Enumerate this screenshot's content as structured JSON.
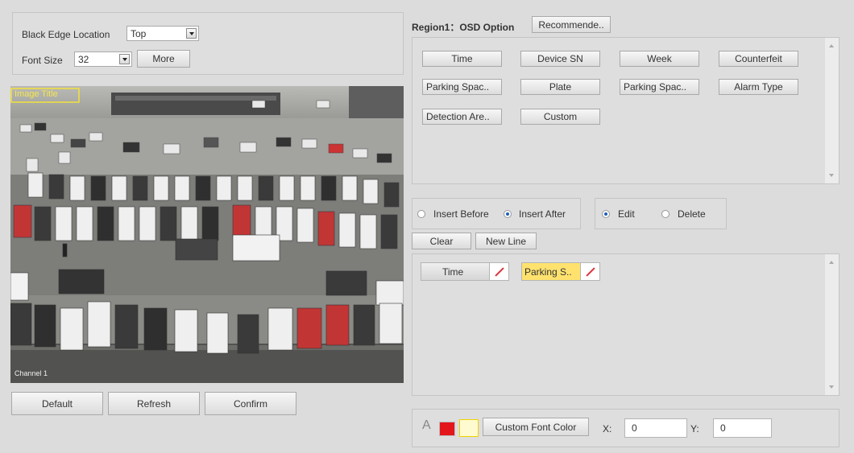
{
  "left": {
    "black_edge_location_label": "Black Edge Location",
    "black_edge_location_value": "Top",
    "font_size_label": "Font Size",
    "font_size_value": "32",
    "more_button": "More",
    "video_overlay": {
      "title_text": "Image Title",
      "channel_text": "Channel 1"
    },
    "default_button": "Default",
    "refresh_button": "Refresh",
    "confirm_button": "Confirm"
  },
  "right": {
    "region_title": "Region1：OSD Option",
    "recommended_button": "Recommende..",
    "osd_options": [
      "Time",
      "Device SN",
      "Week",
      "Counterfeit",
      "Parking Spac..",
      "Plate",
      "Parking Spac..",
      "Alarm Type",
      "Detection Are..",
      "Custom"
    ],
    "insert_before": "Insert Before",
    "insert_after": "Insert After",
    "insert_selected": "after",
    "edit": "Edit",
    "delete": "Delete",
    "mode_selected": "edit",
    "clear_button": "Clear",
    "new_line_button": "New Line",
    "selected_items": [
      {
        "label": "Time",
        "highlighted": false
      },
      {
        "label": "Parking S..",
        "highlighted": true
      }
    ],
    "custom_font_color_button": "Custom Font Color",
    "x_label": "X:",
    "x_value": "0",
    "y_label": "Y:",
    "y_value": "0",
    "colors": {
      "swatch_red": "#e3161b",
      "swatch_yellow": "#fffbd0",
      "highlight": "#ffe26e",
      "accent": "#1f5fb5"
    }
  }
}
